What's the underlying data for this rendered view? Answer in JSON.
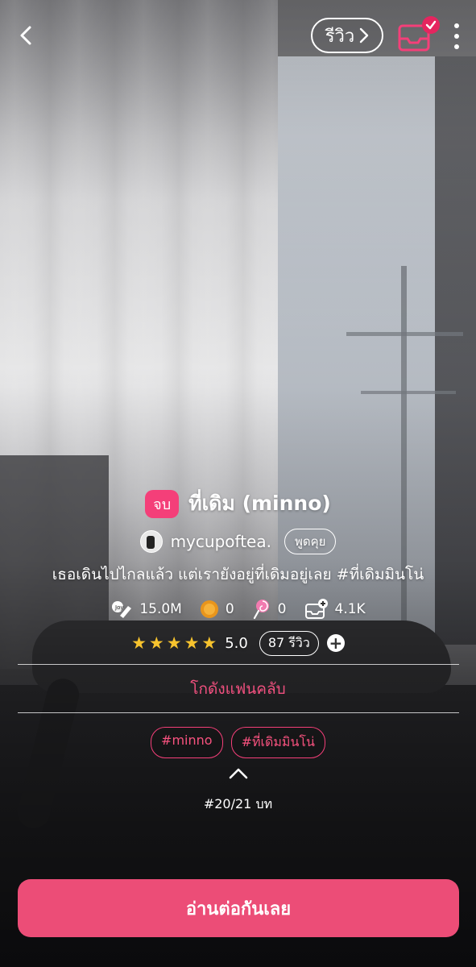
{
  "topbar": {
    "review_label": "รีวิว",
    "accent_color": "#e5255f"
  },
  "story": {
    "status_badge": "จบ",
    "title": "ที่เดิม (minno)",
    "author": "mycupoftea.",
    "chat_label": "พูดคุย",
    "synopsis": "เธอเดินไปไกลแล้ว แต่เรายังอยู่ที่เดิมอยู่เลย #ที่เดิมมินโน่"
  },
  "stats": {
    "views": "15.0M",
    "coins": "0",
    "candies": "0",
    "library_adds": "4.1K"
  },
  "rating": {
    "stars": 5,
    "value": "5.0",
    "review_count": "87 รีวิว"
  },
  "fanclub_label": "โกดังแฟนคลับ",
  "tags": [
    "#minno",
    "#ที่เดิมมินโน่"
  ],
  "chapter_indicator": "#20/21 บท",
  "cta_label": "อ่านต่อกันเลย",
  "colors": {
    "pink": "#f43f79",
    "cta": "#ec4d77",
    "star": "#f7c32e"
  }
}
